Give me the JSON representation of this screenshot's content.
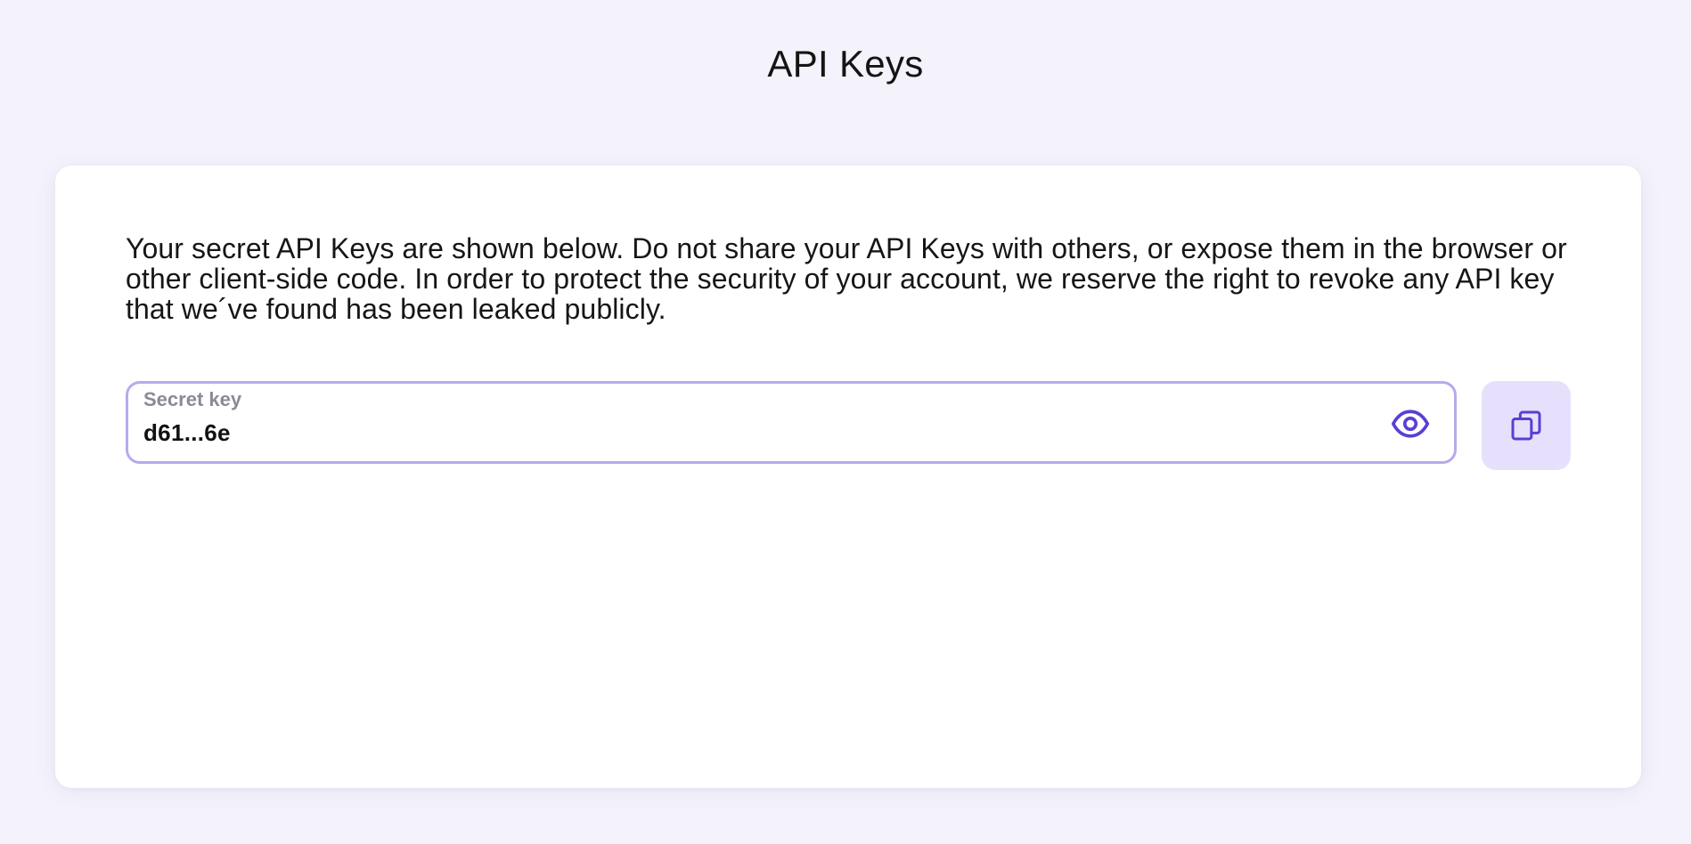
{
  "header": {
    "title": "API Keys"
  },
  "card": {
    "description": "Your secret API Keys are shown below. Do not share your API Keys with others, or expose them in the browser or other client-side code. In order to protect the security of your account, we reserve the right to revoke any API key that we´ve found has been leaked publicly."
  },
  "secret_key": {
    "label": "Secret key",
    "value": "d61...6e",
    "reveal_icon": "eye-icon",
    "copy_icon": "copy-icon"
  },
  "colors": {
    "background": "#f4f2fb",
    "card": "#ffffff",
    "field_border": "#b9a9ec",
    "accent": "#5b3fd4",
    "copy_button_bg": "#e7e0fd",
    "label_gray": "#8c8a96"
  }
}
